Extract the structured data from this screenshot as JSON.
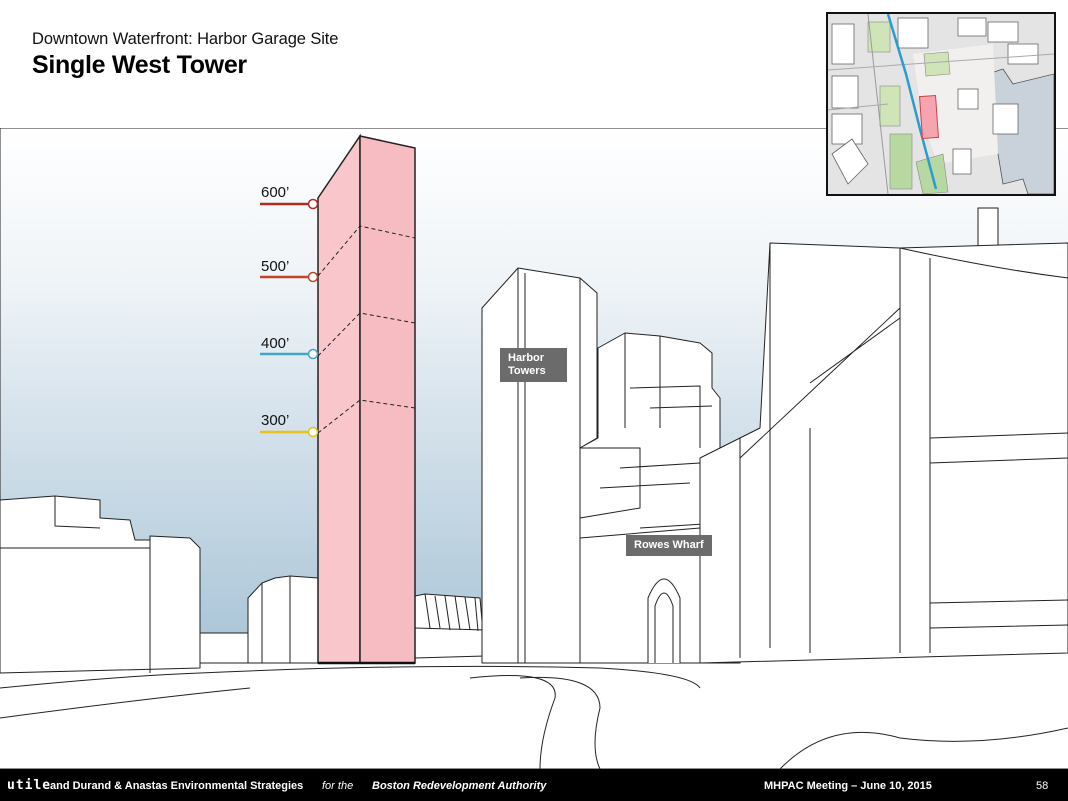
{
  "header": {
    "subtitle": "Downtown Waterfront: Harbor Garage Site",
    "title": "Single West Tower"
  },
  "height_markers": [
    {
      "label": "600’",
      "color": "#b22a22"
    },
    {
      "label": "500’",
      "color": "#c0452a"
    },
    {
      "label": "400’",
      "color": "#3ea6c8"
    },
    {
      "label": "300’",
      "color": "#e6c21e"
    }
  ],
  "labels": {
    "harbor_towers_line1": "Harbor",
    "harbor_towers_line2": "Towers",
    "rowes_wharf": "Rowes Wharf"
  },
  "colors": {
    "tower_fill": "#f9c6cb",
    "sky_top": "#ffffff",
    "sky_bottom": "#a7c3d6",
    "label_bg": "#6b6b6b"
  },
  "footer": {
    "brand": "utile",
    "org": "and Durand & Anastas Environmental Strategies",
    "for_text": "for the",
    "bra": "Boston Redevelopment Authority",
    "meeting": "MHPAC Meeting  – June 10, 2015",
    "page": "58"
  }
}
